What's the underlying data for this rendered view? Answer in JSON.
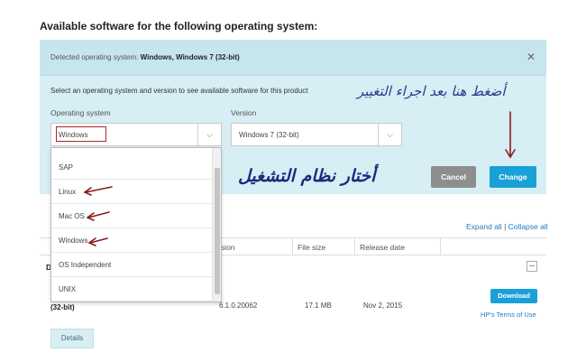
{
  "heading": "Available software for the following operating system:",
  "detected": {
    "label": "Detected operating system:",
    "value": "Windows, Windows 7 (32-bit)"
  },
  "instruction": "Select an operating system and version to see available software for this product",
  "os_label": "Operating system",
  "version_label": "Version",
  "os_selected": "Windows",
  "version_selected": "Windows 7 (32-bit)",
  "dropdown_options": [
    "SAP",
    "Linux",
    "Mac OS",
    "Windows",
    "OS Independent",
    "UNIX"
  ],
  "buttons": {
    "cancel": "Cancel",
    "change": "Change",
    "download": "Download",
    "details": "Details"
  },
  "annotations": {
    "click_here": "أضغط هنا بعد اجراء التغيير",
    "choose_os": "أختار نظام التشغيل"
  },
  "expand_all": "Expand all",
  "separator": "|",
  "collapse_all": "Collapse all",
  "table": {
    "headers": [
      "rsion",
      "File size",
      "Release date"
    ],
    "row": {
      "lead": "D",
      "bit": "(32-bit)",
      "version": "6.1.0.20062",
      "size": "17.1 MB",
      "date": "Nov 2, 2015"
    }
  },
  "terms_link": "HP's Terms of Use",
  "colors": {
    "accent": "#1aa0d8",
    "panel": "#d6eef4",
    "annotation_red": "#b2242f",
    "annotation_blue": "#1a2a7a"
  }
}
